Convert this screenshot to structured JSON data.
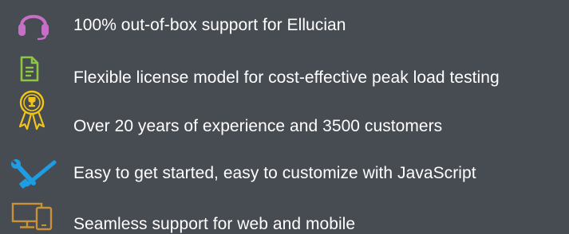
{
  "features": [
    {
      "icon": "headset-icon",
      "color": "#c76fc6",
      "text": "100% out-of-box support for Ellucian"
    },
    {
      "icon": "document-icon",
      "color": "#8dc63f",
      "text": "Flexible license model for cost-effective peak load testing"
    },
    {
      "icon": "award-ribbon-icon",
      "color": "#f0c419",
      "text": "Over 20 years of experience and 3500 customers"
    },
    {
      "icon": "tools-icon",
      "color": "#1e9ce4",
      "text": "Easy to get started, easy to customize with JavaScript"
    },
    {
      "icon": "devices-icon",
      "color": "#c8913a",
      "text": "Seamless support for web and mobile"
    }
  ]
}
